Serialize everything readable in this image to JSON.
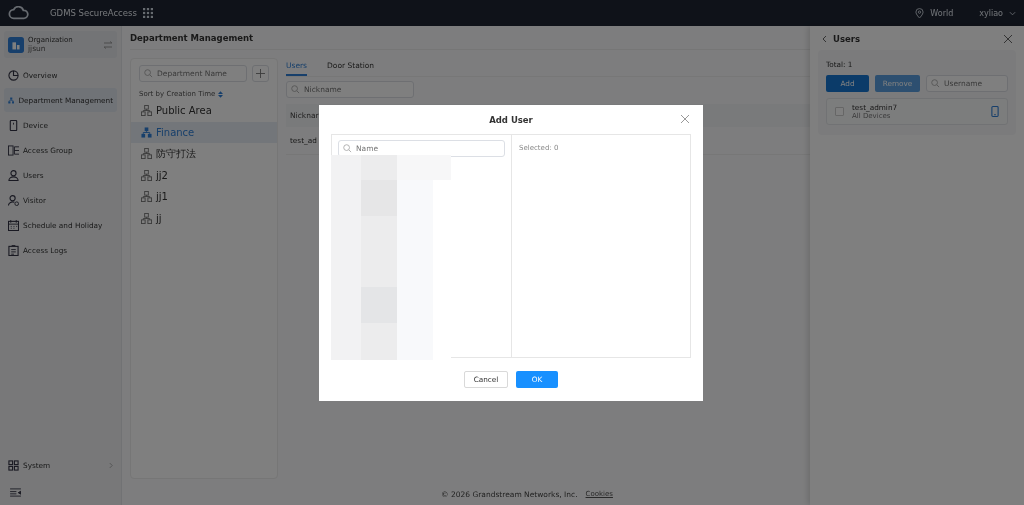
{
  "top_bar": {
    "product": "GDMS SecureAccess",
    "region": "World",
    "user": "xyliao"
  },
  "sidebar": {
    "organization_label": "Organization",
    "organization": "jjsun",
    "items": [
      {
        "label": "Overview",
        "selected": false
      },
      {
        "label": "Department Management",
        "selected": true
      },
      {
        "label": "Device",
        "selected": false
      },
      {
        "label": "Access Group",
        "selected": false
      },
      {
        "label": "Users",
        "selected": false
      },
      {
        "label": "Visitor",
        "selected": false
      },
      {
        "label": "Schedule and Holiday",
        "selected": false
      },
      {
        "label": "Access Logs",
        "selected": false
      }
    ],
    "system": "System"
  },
  "page_title": "Department Management",
  "departments": {
    "placeholder": "Department Name",
    "sort_label": "Sort by Creation Time",
    "items": [
      {
        "name": "Public Area",
        "selected": false
      },
      {
        "name": "Finance",
        "selected": true
      },
      {
        "name": "防守打法",
        "selected": false
      },
      {
        "name": "jj2",
        "selected": false
      },
      {
        "name": "jj1",
        "selected": false
      },
      {
        "name": "jj",
        "selected": false
      }
    ]
  },
  "tabs": [
    {
      "label": "Users",
      "selected": true
    },
    {
      "label": "Door Station",
      "selected": false
    }
  ],
  "nickname_search": {
    "placeholder": "Nickname"
  },
  "table": {
    "columns": [
      "Nicknar"
    ],
    "rows": [
      [
        "test_ad"
      ]
    ]
  },
  "footer": {
    "copyright": "© 2026 Grandstream Networks, Inc.",
    "link": "Cookies"
  },
  "drawer": {
    "title": "Users",
    "total": "Total: 1",
    "add": "Add",
    "remove": "Remove",
    "placeholder": "Username",
    "users": [
      {
        "name": "test_admin7",
        "devices": "All Devices",
        "checked": false
      }
    ]
  },
  "dialog": {
    "title": "Add User",
    "placeholder": "Name",
    "selected_count": "Selected: 0",
    "cancel": "Cancel",
    "ok": "OK"
  }
}
